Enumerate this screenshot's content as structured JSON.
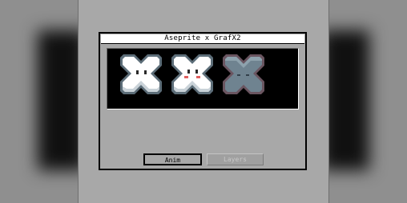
{
  "window": {
    "title": "Aseprite x GrafX2"
  },
  "preview": {
    "icons": [
      {
        "name": "white mascot",
        "face": "eyes",
        "fill": "#ffffff"
      },
      {
        "name": "white mascot with blush",
        "face": "eyes-blush",
        "fill": "#ffffff"
      },
      {
        "name": "grey mascot",
        "face": "eyes",
        "fill": "#6f8390"
      }
    ]
  },
  "buttons": {
    "anim_label": "Anim",
    "layers_label": "Layers"
  },
  "colors": {
    "background": "#a8a8a8",
    "titlebar": "#ffffff",
    "canvas": "#000000",
    "blush": "#e06060",
    "disabled_text": "#c8c8c8"
  }
}
